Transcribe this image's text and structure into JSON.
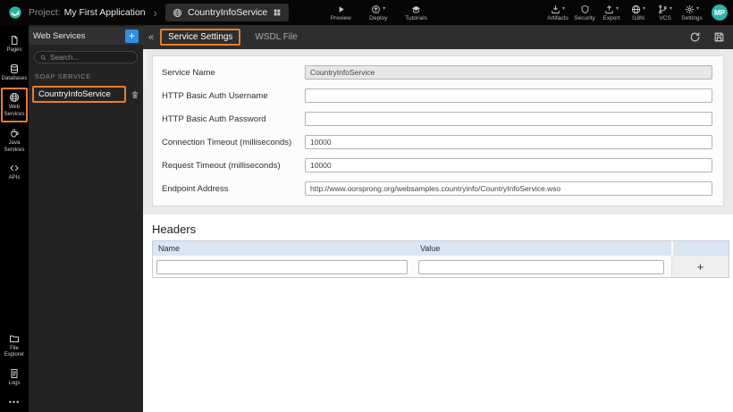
{
  "topbar": {
    "project_label": "Project:",
    "project_name": "My First Application",
    "entity_name": "CountryInfoService",
    "preview_label": "Preview",
    "deploy_label": "Deploy",
    "tutorials_label": "Tutorials",
    "artifacts_label": "Artifacts",
    "security_label": "Security",
    "export_label": "Export",
    "i18n_label": "I18N",
    "vcs_label": "VCS",
    "settings_label": "Settings",
    "avatar_initials": "MP"
  },
  "icons": {
    "caret_down": "▾",
    "breadcrumb_chevron": "›",
    "collapse": "«",
    "ellipsis": "•••",
    "add": "+"
  },
  "rail": {
    "items": [
      {
        "label": "Pages"
      },
      {
        "label": "Databases"
      },
      {
        "label": "Web Services",
        "active": true
      },
      {
        "label": "Java Services"
      },
      {
        "label": "APIs"
      }
    ],
    "bottom_items": [
      {
        "label": "File Explorer"
      },
      {
        "label": "Logs"
      }
    ]
  },
  "sidebar": {
    "title": "Web Services",
    "search_placeholder": "Search...",
    "section_label": "SOAP SERVICE",
    "items": [
      {
        "label": "CountryInfoService"
      }
    ]
  },
  "tabs": {
    "service_settings": "Service Settings",
    "wsdl_file": "WSDL File"
  },
  "form": {
    "fields": [
      {
        "label": "Service Name",
        "value": "CountryInfoService",
        "disabled": true
      },
      {
        "label": "HTTP Basic Auth Username",
        "value": ""
      },
      {
        "label": "HTTP Basic Auth Password",
        "value": ""
      },
      {
        "label": "Connection Timeout (milliseconds)",
        "value": "10000"
      },
      {
        "label": "Request Timeout (milliseconds)",
        "value": "10000"
      },
      {
        "label": "Endpoint Address",
        "value": "http://www.oorsprong.org/websamples.countryinfo/CountryInfoService.wso"
      }
    ]
  },
  "headers": {
    "title": "Headers",
    "name_column": "Name",
    "value_column": "Value",
    "add_button": "+"
  },
  "colors": {
    "highlight_orange": "#e87e2b",
    "accent_blue": "#2f8fe8",
    "avatar_teal": "#2fb3a8",
    "table_header_blue": "#d9e7f4"
  }
}
